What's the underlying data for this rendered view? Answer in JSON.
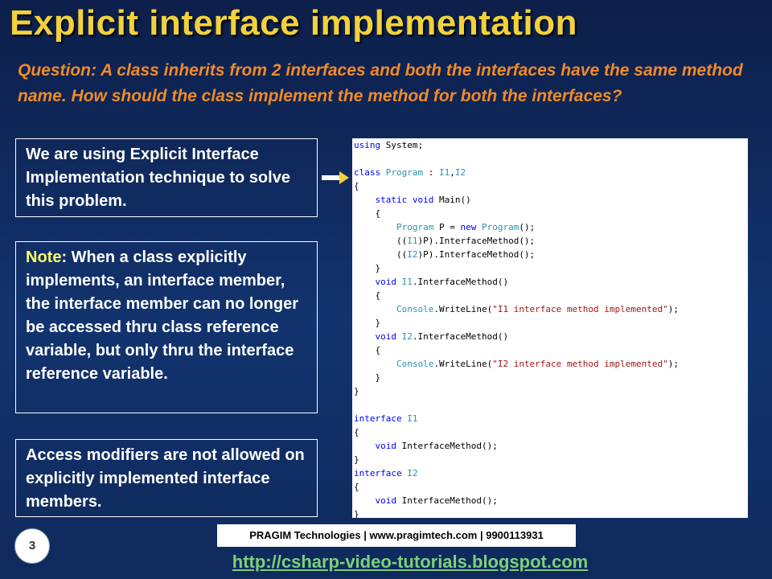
{
  "title": "Explicit interface implementation",
  "question": "Question: A class inherits from 2 interfaces and both the interfaces have the same method name. How should the class implement the method for both the interfaces?",
  "box1": {
    "text": "We are using Explicit Interface Implementation technique to solve this problem."
  },
  "box2": {
    "label": "Note",
    "text": ": When a class explicitly implements, an interface member, the interface member can no longer be accessed thru class reference variable, but only thru the interface reference variable."
  },
  "box3": {
    "text": "Access modifiers are not allowed on explicitly implemented interface members."
  },
  "code_lines": [
    "using System;",
    "",
    "class Program : I1,I2",
    "{",
    "    static void Main()",
    "    {",
    "        Program P = new Program();",
    "        ((I1)P).InterfaceMethod();",
    "        ((I2)P).InterfaceMethod();",
    "    }",
    "    void I1.InterfaceMethod()",
    "    {",
    "        Console.WriteLine(\"I1 interface method implemented\");",
    "    }",
    "    void I2.InterfaceMethod()",
    "    {",
    "        Console.WriteLine(\"I2 interface method implemented\");",
    "    }",
    "}",
    "",
    "interface I1",
    "{",
    "    void InterfaceMethod();",
    "}",
    "interface I2",
    "{",
    "    void InterfaceMethod();",
    "}"
  ],
  "slide_number": "3",
  "footer_bar": "PRAGIM Technologies | www.pragimtech.com | 9900113931",
  "footer_link": "http://csharp-video-tutorials.blogspot.com",
  "colors": {
    "title": "#f2d23a",
    "question": "#f08a2a",
    "note_label": "#ffff66",
    "link": "#7dd07a",
    "keyword": "#0000ff",
    "type": "#2b91af",
    "string": "#a31515"
  },
  "icons": {
    "arrow": "right-arrow-icon"
  }
}
